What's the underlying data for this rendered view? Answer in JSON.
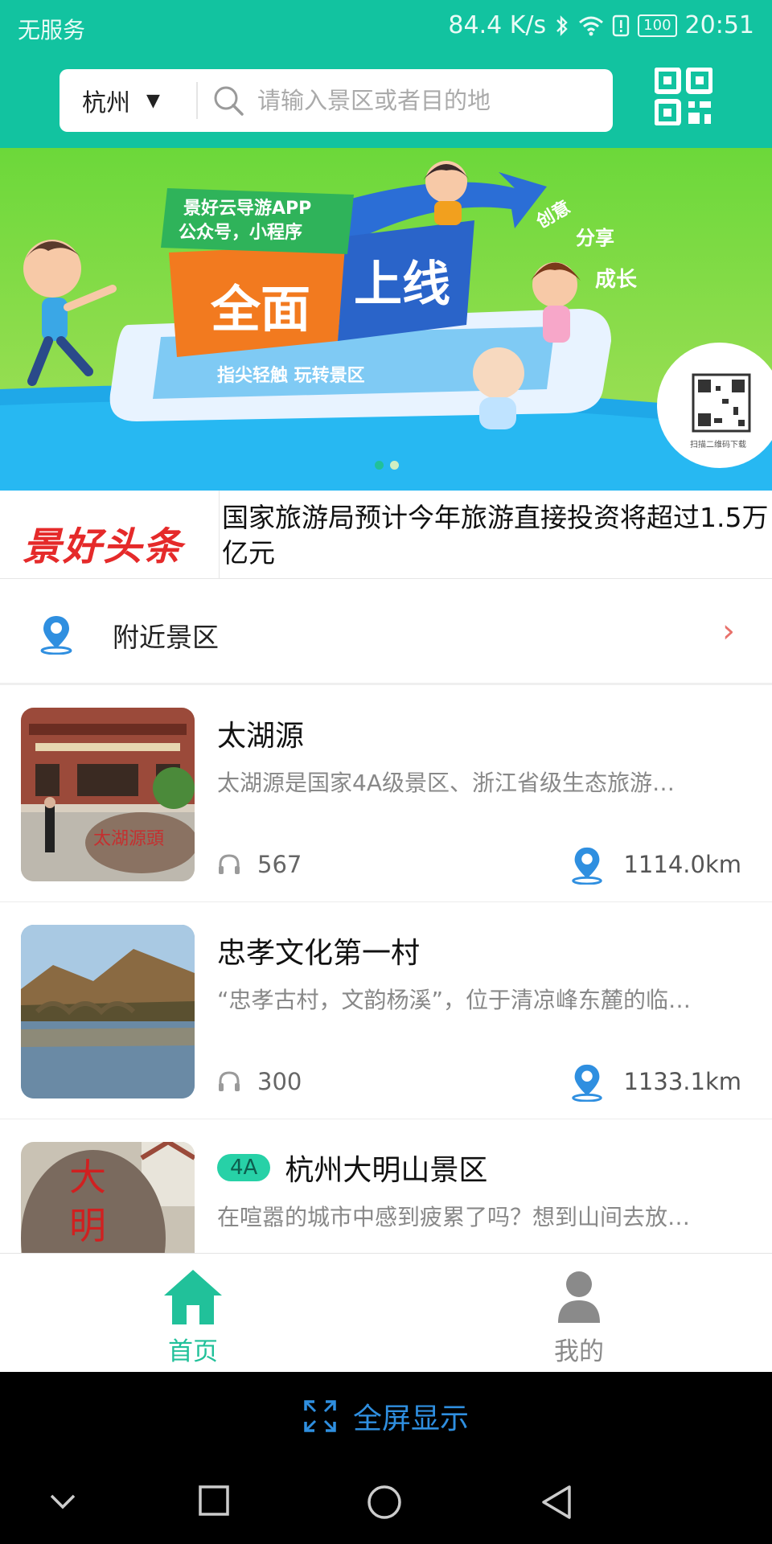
{
  "status_bar": {
    "carrier": "无服务",
    "net_speed": "84.4 K/s",
    "battery": "100",
    "time": "20:51"
  },
  "header": {
    "city": "杭州",
    "search_placeholder": "请输入景区或者目的地"
  },
  "banner": {
    "slide_count": 2,
    "active_slide": 1,
    "tag": "景好云导游APP\n公众号，小程序",
    "headline": "全面上线",
    "tagline": "指尖轻触 玩转景区",
    "side_words": [
      "创意",
      "分享",
      "成长"
    ],
    "qr_caption": "扫描二维码下载"
  },
  "ticker": {
    "logo": "景好头条",
    "text": "国家旅游局预计今年旅游直接投资将超过1.5万亿元"
  },
  "nearby": {
    "label": "附近景区"
  },
  "list": {
    "items": [
      {
        "title": "太湖源",
        "badge": "",
        "desc": "太湖源是国家4A级景区、浙江省级生态旅游…",
        "plays": "567",
        "distance": "1114.0km"
      },
      {
        "title": "忠孝文化第一村",
        "badge": "",
        "desc": "“忠孝古村，文韵杨溪”，位于清凉峰东麓的临…",
        "plays": "300",
        "distance": "1133.1km"
      },
      {
        "title": "杭州大明山景区",
        "badge": "4A",
        "desc": "在喧嚣的城市中感到疲累了吗？想到山间去放…",
        "plays": "",
        "distance": ""
      }
    ]
  },
  "bottom_nav": {
    "home": "首页",
    "mine": "我的"
  },
  "fullscreen_bar": {
    "label": "全屏显示"
  },
  "colors": {
    "brand": "#12c3a0",
    "accent_green": "#21c19a",
    "ticker_red": "#e52a2a",
    "pin_blue": "#2f8fe0"
  },
  "icons": [
    "qr-code-icon",
    "search-icon",
    "location-pin-icon",
    "chevron-right-icon",
    "headphones-icon",
    "home-icon",
    "user-icon",
    "fullscreen-icon"
  ]
}
